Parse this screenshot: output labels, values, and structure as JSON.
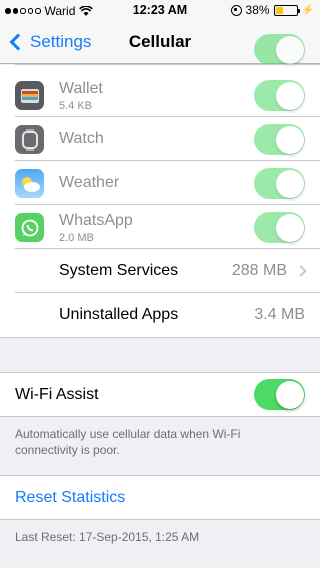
{
  "status_bar": {
    "carrier": "Warid",
    "time": "12:23 AM",
    "battery": "38%",
    "battery_level": 0.38
  },
  "nav": {
    "back_label": "Settings",
    "title": "Cellular"
  },
  "apps": [
    {
      "name": "Wallet",
      "size": "5.4 KB",
      "icon": "wallet-icon",
      "enabled": true
    },
    {
      "name": "Watch",
      "size": "",
      "icon": "watch-icon",
      "enabled": true
    },
    {
      "name": "Weather",
      "size": "",
      "icon": "weather-icon",
      "enabled": true
    },
    {
      "name": "WhatsApp",
      "size": "2.0 MB",
      "icon": "whatsapp-icon",
      "enabled": true
    }
  ],
  "system_services": {
    "label": "System Services",
    "value": "288 MB"
  },
  "uninstalled_apps": {
    "label": "Uninstalled Apps",
    "value": "3.4 MB"
  },
  "wifi_assist": {
    "label": "Wi-Fi Assist",
    "enabled": true,
    "description": "Automatically use cellular data when Wi-Fi connectivity is poor."
  },
  "reset": {
    "label": "Reset Statistics",
    "last_reset": "Last Reset: 17-Sep-2015, 1:25 AM"
  },
  "colors": {
    "accent": "#147efb",
    "toggle_on": "#4cd964"
  }
}
